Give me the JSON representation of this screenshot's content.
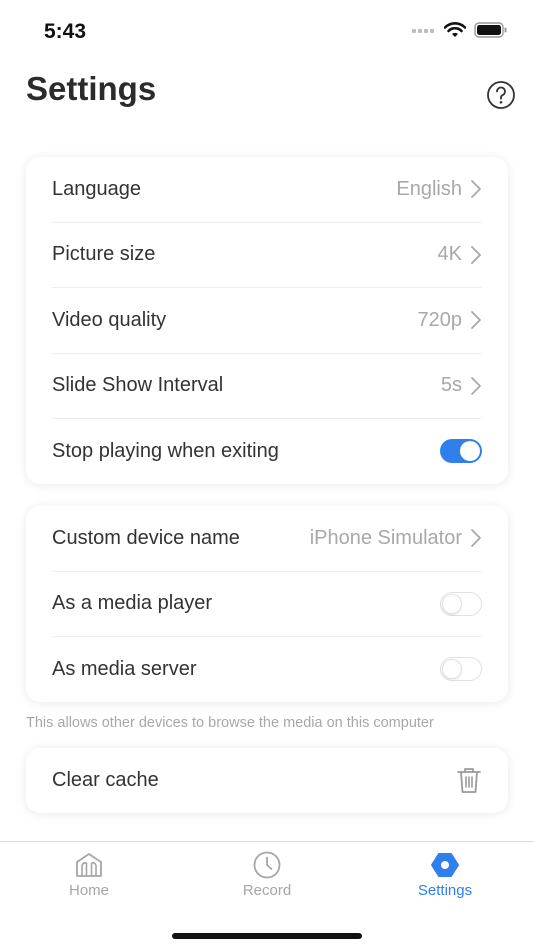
{
  "status_bar": {
    "time": "5:43"
  },
  "header": {
    "title": "Settings"
  },
  "group1": {
    "language": {
      "label": "Language",
      "value": "English"
    },
    "picture_size": {
      "label": "Picture size",
      "value": "4K"
    },
    "video_quality": {
      "label": "Video quality",
      "value": "720p"
    },
    "slide_show": {
      "label": "Slide Show Interval",
      "value": "5s"
    },
    "stop_playing": {
      "label": "Stop playing when exiting",
      "enabled": true
    }
  },
  "group2": {
    "device_name": {
      "label": "Custom device name",
      "value": "iPhone Simulator"
    },
    "media_player": {
      "label": "As a media player",
      "enabled": false
    },
    "media_server": {
      "label": "As media server",
      "enabled": false
    }
  },
  "note": "This allows other devices to browse the media on this computer",
  "group3": {
    "clear_cache": {
      "label": "Clear cache"
    }
  },
  "tabbar": {
    "home": "Home",
    "record": "Record",
    "settings": "Settings",
    "active": "settings"
  },
  "colors": {
    "accent": "#2f80ed",
    "secondary_text": "#a8a8a8",
    "primary_text": "#333333"
  },
  "icons": [
    "help-icon",
    "chevron-right-icon",
    "trash-icon",
    "home-icon",
    "clock-icon",
    "hexagon-settings-icon",
    "wifi-icon",
    "battery-icon",
    "signal-icon"
  ]
}
